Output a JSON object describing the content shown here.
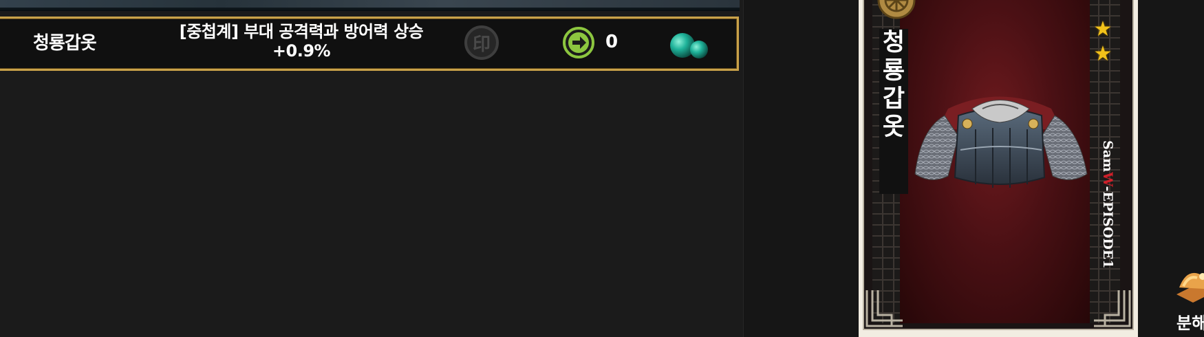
{
  "item_row": {
    "name": "청룡갑옷",
    "description": "[중첩계] 부대 공격력과 방어력 상승 +0.9%",
    "seal_glyph": "印",
    "count": "0"
  },
  "card": {
    "name_chars": [
      "청",
      "룡",
      "갑",
      "옷"
    ],
    "stars": [
      "★",
      "★"
    ],
    "brand_prefix": "Sam",
    "brand_w": "W",
    "brand_suffix": "-EPISODE1"
  },
  "actions": {
    "disassemble_label": "분해"
  },
  "colors": {
    "row_border": "#c9a24a",
    "arrow_green": "#8cc63f",
    "gem_teal": "#1fb39a",
    "star_gold": "#f2c21a",
    "card_red": "#6e1a1e"
  },
  "icons": {
    "seal": "seal-icon",
    "arrow": "arrow-right-circle-icon",
    "gem": "jade-gem-icon",
    "disassemble": "disassemble-icon"
  }
}
